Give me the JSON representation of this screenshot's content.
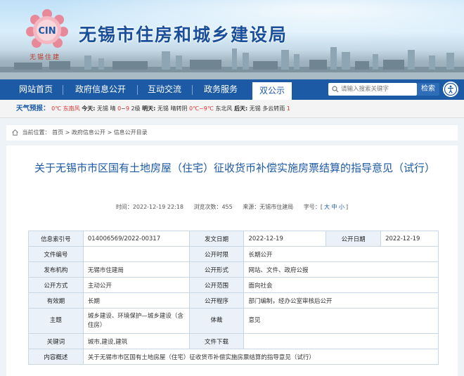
{
  "header": {
    "site_title": "无锡市住房和城乡建设局",
    "logo_text": "CIN",
    "logo_caption": "无锡住建"
  },
  "nav": {
    "items": [
      {
        "label": "网站首页"
      },
      {
        "label": "政府信息公开"
      },
      {
        "label": "互动交流"
      },
      {
        "label": "政务服务"
      },
      {
        "label": "双公示"
      }
    ],
    "active_index": 4,
    "search_placeholder": "请输入搜索关键字",
    "search_button": "检索"
  },
  "weather": {
    "label": "天气预报：",
    "today_loc_temp": "0℃ 东南风",
    "today_label": "今天:",
    "today_weather": "无锡 晴",
    "today_range_low": "0",
    "today_range_sep": "~",
    "today_range_high": "9",
    "today_wind": "2级",
    "tomorrow_label": "明天:",
    "tomorrow_weather": "无锡 晴转阴",
    "tomorrow_range": "0℃~9℃",
    "tomorrow_wind": "东北风",
    "after_label": "后天:",
    "after_weather": "无锡 多云转雨",
    "after_tail": "1"
  },
  "breadcrumb": {
    "items": [
      "当前位置：",
      "首页",
      "政府信息公开",
      "信息公开目录"
    ],
    "sep": ">"
  },
  "document": {
    "title": "关于无锡市市区国有土地房屋（住宅）征收货币补偿实施房票结算的指导意见（试行）",
    "time_label": "时间：",
    "time_value": "2022-12-19 22:18",
    "views_label": "浏览次数：",
    "views_value": "455",
    "source_label": "来源：",
    "source_value": "无锡市住建局",
    "fontsize_label": "字号：",
    "fontsize_open": "[",
    "fontsize_large": "大",
    "fontsize_medium": "中",
    "fontsize_small": "小",
    "fontsize_close": "]"
  },
  "info_table": {
    "row1": {
      "k1": "信息索引号",
      "v1": "014006569/2022-00317",
      "k2": "发文日期",
      "v2": "2022-12-19",
      "k3": "公开日期",
      "v3": "2022-12-19"
    },
    "row2": {
      "k1": "文件编号",
      "v1": "",
      "k2": "公开时限",
      "v2": "长期公开"
    },
    "row3": {
      "k1": "发布机构",
      "v1": "无锡市住建局",
      "k2": "公开形式",
      "v2": "网站、文件、政府公报"
    },
    "row4": {
      "k1": "公开方式",
      "v1": "主动公开",
      "k2": "公开范围",
      "v2": "面向社会"
    },
    "row5": {
      "k1": "有效期",
      "v1": "长期",
      "k2": "公开程序",
      "v2": "部门编制，经办公室审核后公开"
    },
    "row6": {
      "k1": "主题",
      "v1": "城乡建设、环境保护—城乡建设（含住房）",
      "k2": "体裁",
      "v2": "意见"
    },
    "row7": {
      "k1": "关键词",
      "v1": "城市,建设,建筑",
      "k2": "文件下载",
      "v2": ""
    },
    "row8": {
      "k1": "内容概述",
      "v1": "关于无锡市市区国有土地房屋（住宅）征收货币补偿实施房票结算的指导意见（试行）"
    }
  }
}
